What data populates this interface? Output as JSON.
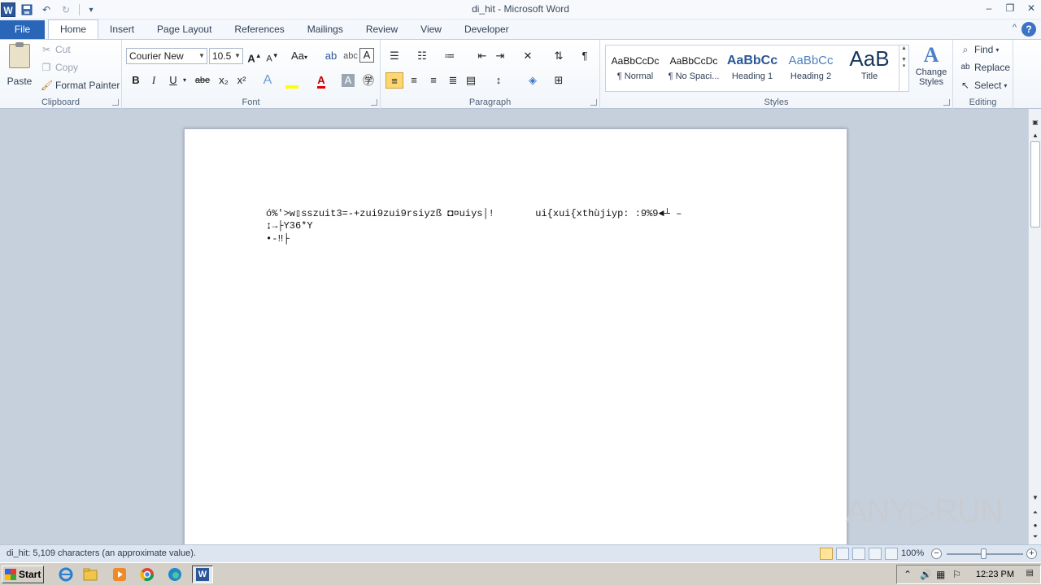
{
  "window": {
    "title": "di_hit  -  Microsoft Word",
    "minimize": "–",
    "restore": "❐",
    "close": "✕"
  },
  "quick_access": {
    "app_icon": "W",
    "save_icon": "💾",
    "undo_icon": "↶",
    "redo_icon": "↻",
    "customize_icon": "▾"
  },
  "tabs": [
    "File",
    "Home",
    "Insert",
    "Page Layout",
    "References",
    "Mailings",
    "Review",
    "View",
    "Developer"
  ],
  "active_tab": "Home",
  "help_icon": "?",
  "minimize_ribbon_icon": "^",
  "clipboard": {
    "group_label": "Clipboard",
    "paste": "Paste",
    "cut": "Cut",
    "copy": "Copy",
    "format_painter": "Format Painter"
  },
  "font": {
    "group_label": "Font",
    "font_name": "Courier New",
    "font_size": "10.5",
    "grow": "A",
    "shrink": "A",
    "change_case": "Aa",
    "bold": "B",
    "italic": "I",
    "underline": "U",
    "strike": "abe",
    "subscript": "x₂",
    "superscript": "x²"
  },
  "paragraph": {
    "group_label": "Paragraph",
    "show_marks": "¶"
  },
  "styles": {
    "group_label": "Styles",
    "items": [
      {
        "preview": "AaBbCcDc",
        "name": "¶ Normal"
      },
      {
        "preview": "AaBbCcDc",
        "name": "¶ No Spaci..."
      },
      {
        "preview": "AaBbCc",
        "name": "Heading 1"
      },
      {
        "preview": "AaBbCc",
        "name": "Heading 2"
      },
      {
        "preview": "AaB",
        "name": "Title"
      }
    ],
    "change_styles": "Change Styles"
  },
  "editing": {
    "group_label": "Editing",
    "find": "Find",
    "replace": "Replace",
    "select": "Select"
  },
  "document": {
    "lines": [
      "ó%'>w▯sszuit3=-+zui9zui9rsiyzß ◘¤uiys│!       ui{xui{xthùjiyp: :9%9◄┴ –",
      "↨→├Y36*Y",
      "•-‼├"
    ]
  },
  "watermark": "ANY▷RUN",
  "status": {
    "text": "di_hit: 5,109 characters (an approximate value).",
    "zoom": "100%",
    "zoom_out": "−",
    "zoom_in": "+"
  },
  "taskbar": {
    "start": "Start",
    "clock": "12:23 PM"
  }
}
